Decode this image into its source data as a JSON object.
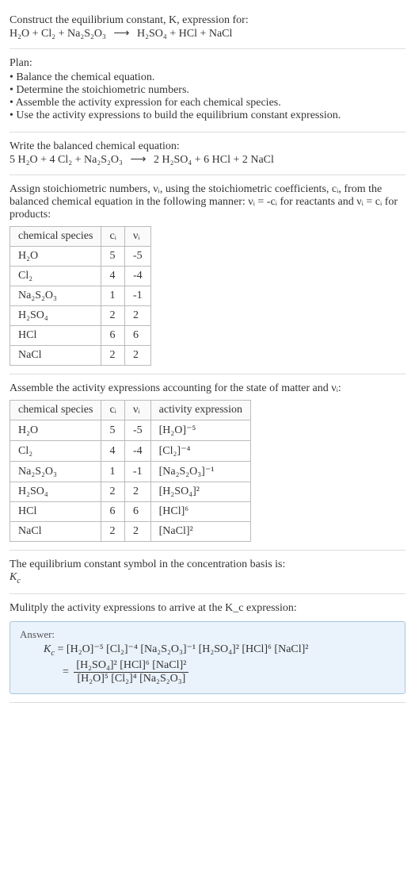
{
  "section1": {
    "line1": "Construct the equilibrium constant, K, expression for:",
    "eq_lhs": "H₂O + Cl₂ + Na₂S₂O₃",
    "eq_arrow": "⟶",
    "eq_rhs": "H₂SO₄ + HCl + NaCl"
  },
  "section2": {
    "title": "Plan:",
    "bullets": [
      "Balance the chemical equation.",
      "Determine the stoichiometric numbers.",
      "Assemble the activity expression for each chemical species.",
      "Use the activity expressions to build the equilibrium constant expression."
    ]
  },
  "section3": {
    "title": "Write the balanced chemical equation:",
    "eq_lhs": "5 H₂O + 4 Cl₂ + Na₂S₂O₃",
    "eq_arrow": "⟶",
    "eq_rhs": "2 H₂SO₄ + 6 HCl + 2 NaCl"
  },
  "section4": {
    "intro": "Assign stoichiometric numbers, νᵢ, using the stoichiometric coefficients, cᵢ, from the balanced chemical equation in the following manner: νᵢ = -cᵢ for reactants and νᵢ = cᵢ for products:",
    "headers": [
      "chemical species",
      "cᵢ",
      "νᵢ"
    ],
    "rows": [
      [
        "H₂O",
        "5",
        "-5"
      ],
      [
        "Cl₂",
        "4",
        "-4"
      ],
      [
        "Na₂S₂O₃",
        "1",
        "-1"
      ],
      [
        "H₂SO₄",
        "2",
        "2"
      ],
      [
        "HCl",
        "6",
        "6"
      ],
      [
        "NaCl",
        "2",
        "2"
      ]
    ]
  },
  "section5": {
    "intro": "Assemble the activity expressions accounting for the state of matter and νᵢ:",
    "headers": [
      "chemical species",
      "cᵢ",
      "νᵢ",
      "activity expression"
    ],
    "rows": [
      [
        "H₂O",
        "5",
        "-5",
        "[H₂O]⁻⁵"
      ],
      [
        "Cl₂",
        "4",
        "-4",
        "[Cl₂]⁻⁴"
      ],
      [
        "Na₂S₂O₃",
        "1",
        "-1",
        "[Na₂S₂O₃]⁻¹"
      ],
      [
        "H₂SO₄",
        "2",
        "2",
        "[H₂SO₄]²"
      ],
      [
        "HCl",
        "6",
        "6",
        "[HCl]⁶"
      ],
      [
        "NaCl",
        "2",
        "2",
        "[NaCl]²"
      ]
    ]
  },
  "section6": {
    "line1": "The equilibrium constant symbol in the concentration basis is:",
    "symbol": "K_c"
  },
  "section7": {
    "intro": "Mulitply the activity expressions to arrive at the K_c expression:",
    "answer_label": "Answer:",
    "kc_eq_prefix": "K_c = ",
    "kc_flat": "[H₂O]⁻⁵ [Cl₂]⁻⁴ [Na₂S₂O₃]⁻¹ [H₂SO₄]² [HCl]⁶ [NaCl]²",
    "eq_sign": "=",
    "frac_num": "[H₂SO₄]² [HCl]⁶ [NaCl]²",
    "frac_den": "[H₂O]⁵ [Cl₂]⁴ [Na₂S₂O₃]"
  },
  "chart_data": {
    "type": "table",
    "tables": [
      {
        "title": "Stoichiometric numbers",
        "columns": [
          "chemical species",
          "c_i",
          "ν_i"
        ],
        "rows": [
          {
            "chemical species": "H2O",
            "c_i": 5,
            "ν_i": -5
          },
          {
            "chemical species": "Cl2",
            "c_i": 4,
            "ν_i": -4
          },
          {
            "chemical species": "Na2S2O3",
            "c_i": 1,
            "ν_i": -1
          },
          {
            "chemical species": "H2SO4",
            "c_i": 2,
            "ν_i": 2
          },
          {
            "chemical species": "HCl",
            "c_i": 6,
            "ν_i": 6
          },
          {
            "chemical species": "NaCl",
            "c_i": 2,
            "ν_i": 2
          }
        ]
      },
      {
        "title": "Activity expressions",
        "columns": [
          "chemical species",
          "c_i",
          "ν_i",
          "activity expression"
        ],
        "rows": [
          {
            "chemical species": "H2O",
            "c_i": 5,
            "ν_i": -5,
            "activity expression": "[H2O]^-5"
          },
          {
            "chemical species": "Cl2",
            "c_i": 4,
            "ν_i": -4,
            "activity expression": "[Cl2]^-4"
          },
          {
            "chemical species": "Na2S2O3",
            "c_i": 1,
            "ν_i": -1,
            "activity expression": "[Na2S2O3]^-1"
          },
          {
            "chemical species": "H2SO4",
            "c_i": 2,
            "ν_i": 2,
            "activity expression": "[H2SO4]^2"
          },
          {
            "chemical species": "HCl",
            "c_i": 6,
            "ν_i": 6,
            "activity expression": "[HCl]^6"
          },
          {
            "chemical species": "NaCl",
            "c_i": 2,
            "ν_i": 2,
            "activity expression": "[NaCl]^2"
          }
        ]
      }
    ]
  }
}
